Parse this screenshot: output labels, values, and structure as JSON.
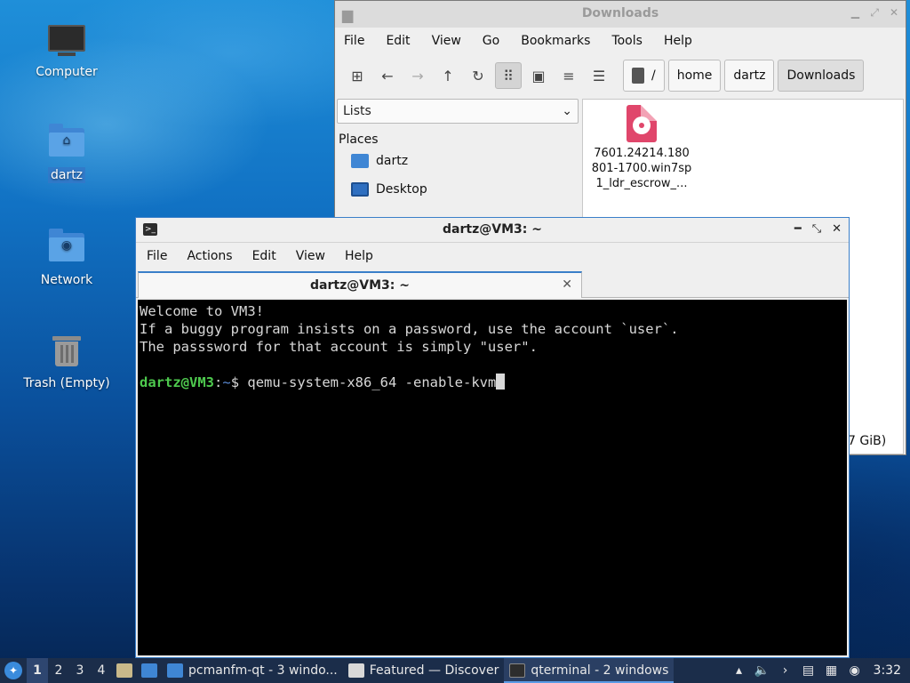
{
  "desktop": {
    "icons": [
      {
        "label": "Computer"
      },
      {
        "label": "dartz"
      },
      {
        "label": "Network"
      },
      {
        "label": "Trash (Empty)"
      }
    ]
  },
  "file_manager": {
    "title": "Downloads",
    "menu": [
      "File",
      "Edit",
      "View",
      "Go",
      "Bookmarks",
      "Tools",
      "Help"
    ],
    "breadcrumbs": [
      "/",
      "home",
      "dartz",
      "Downloads"
    ],
    "side_mode": "Lists",
    "places_heading": "Places",
    "places": [
      "dartz",
      "Desktop"
    ],
    "file": {
      "line1": "7601.24214.180",
      "line2": "801-1700.win7sp",
      "line3": "1_ldr_escrow_..."
    },
    "status_fragment": "7 GiB)"
  },
  "terminal": {
    "title": "dartz@VM3: ~",
    "menu": [
      "File",
      "Actions",
      "Edit",
      "View",
      "Help"
    ],
    "tab_title": "dartz@VM3: ~",
    "lines": [
      "Welcome to VM3!",
      "If a buggy program insists on a password, use the account `user`.",
      "The passsword for that account is simply \"user\"."
    ],
    "prompt_user": "dartz@VM3",
    "prompt_sep": ":",
    "prompt_path": "~",
    "prompt_sym": "$ ",
    "command": "qemu-system-x86_64 -enable-kvm"
  },
  "taskbar": {
    "desktops": [
      "1",
      "2",
      "3",
      "4"
    ],
    "tasks": [
      {
        "label": "pcmanfm-qt - 3 windo..."
      },
      {
        "label": "Featured — Discover"
      },
      {
        "label": "qterminal - 2 windows"
      }
    ],
    "clock": "3:32"
  }
}
